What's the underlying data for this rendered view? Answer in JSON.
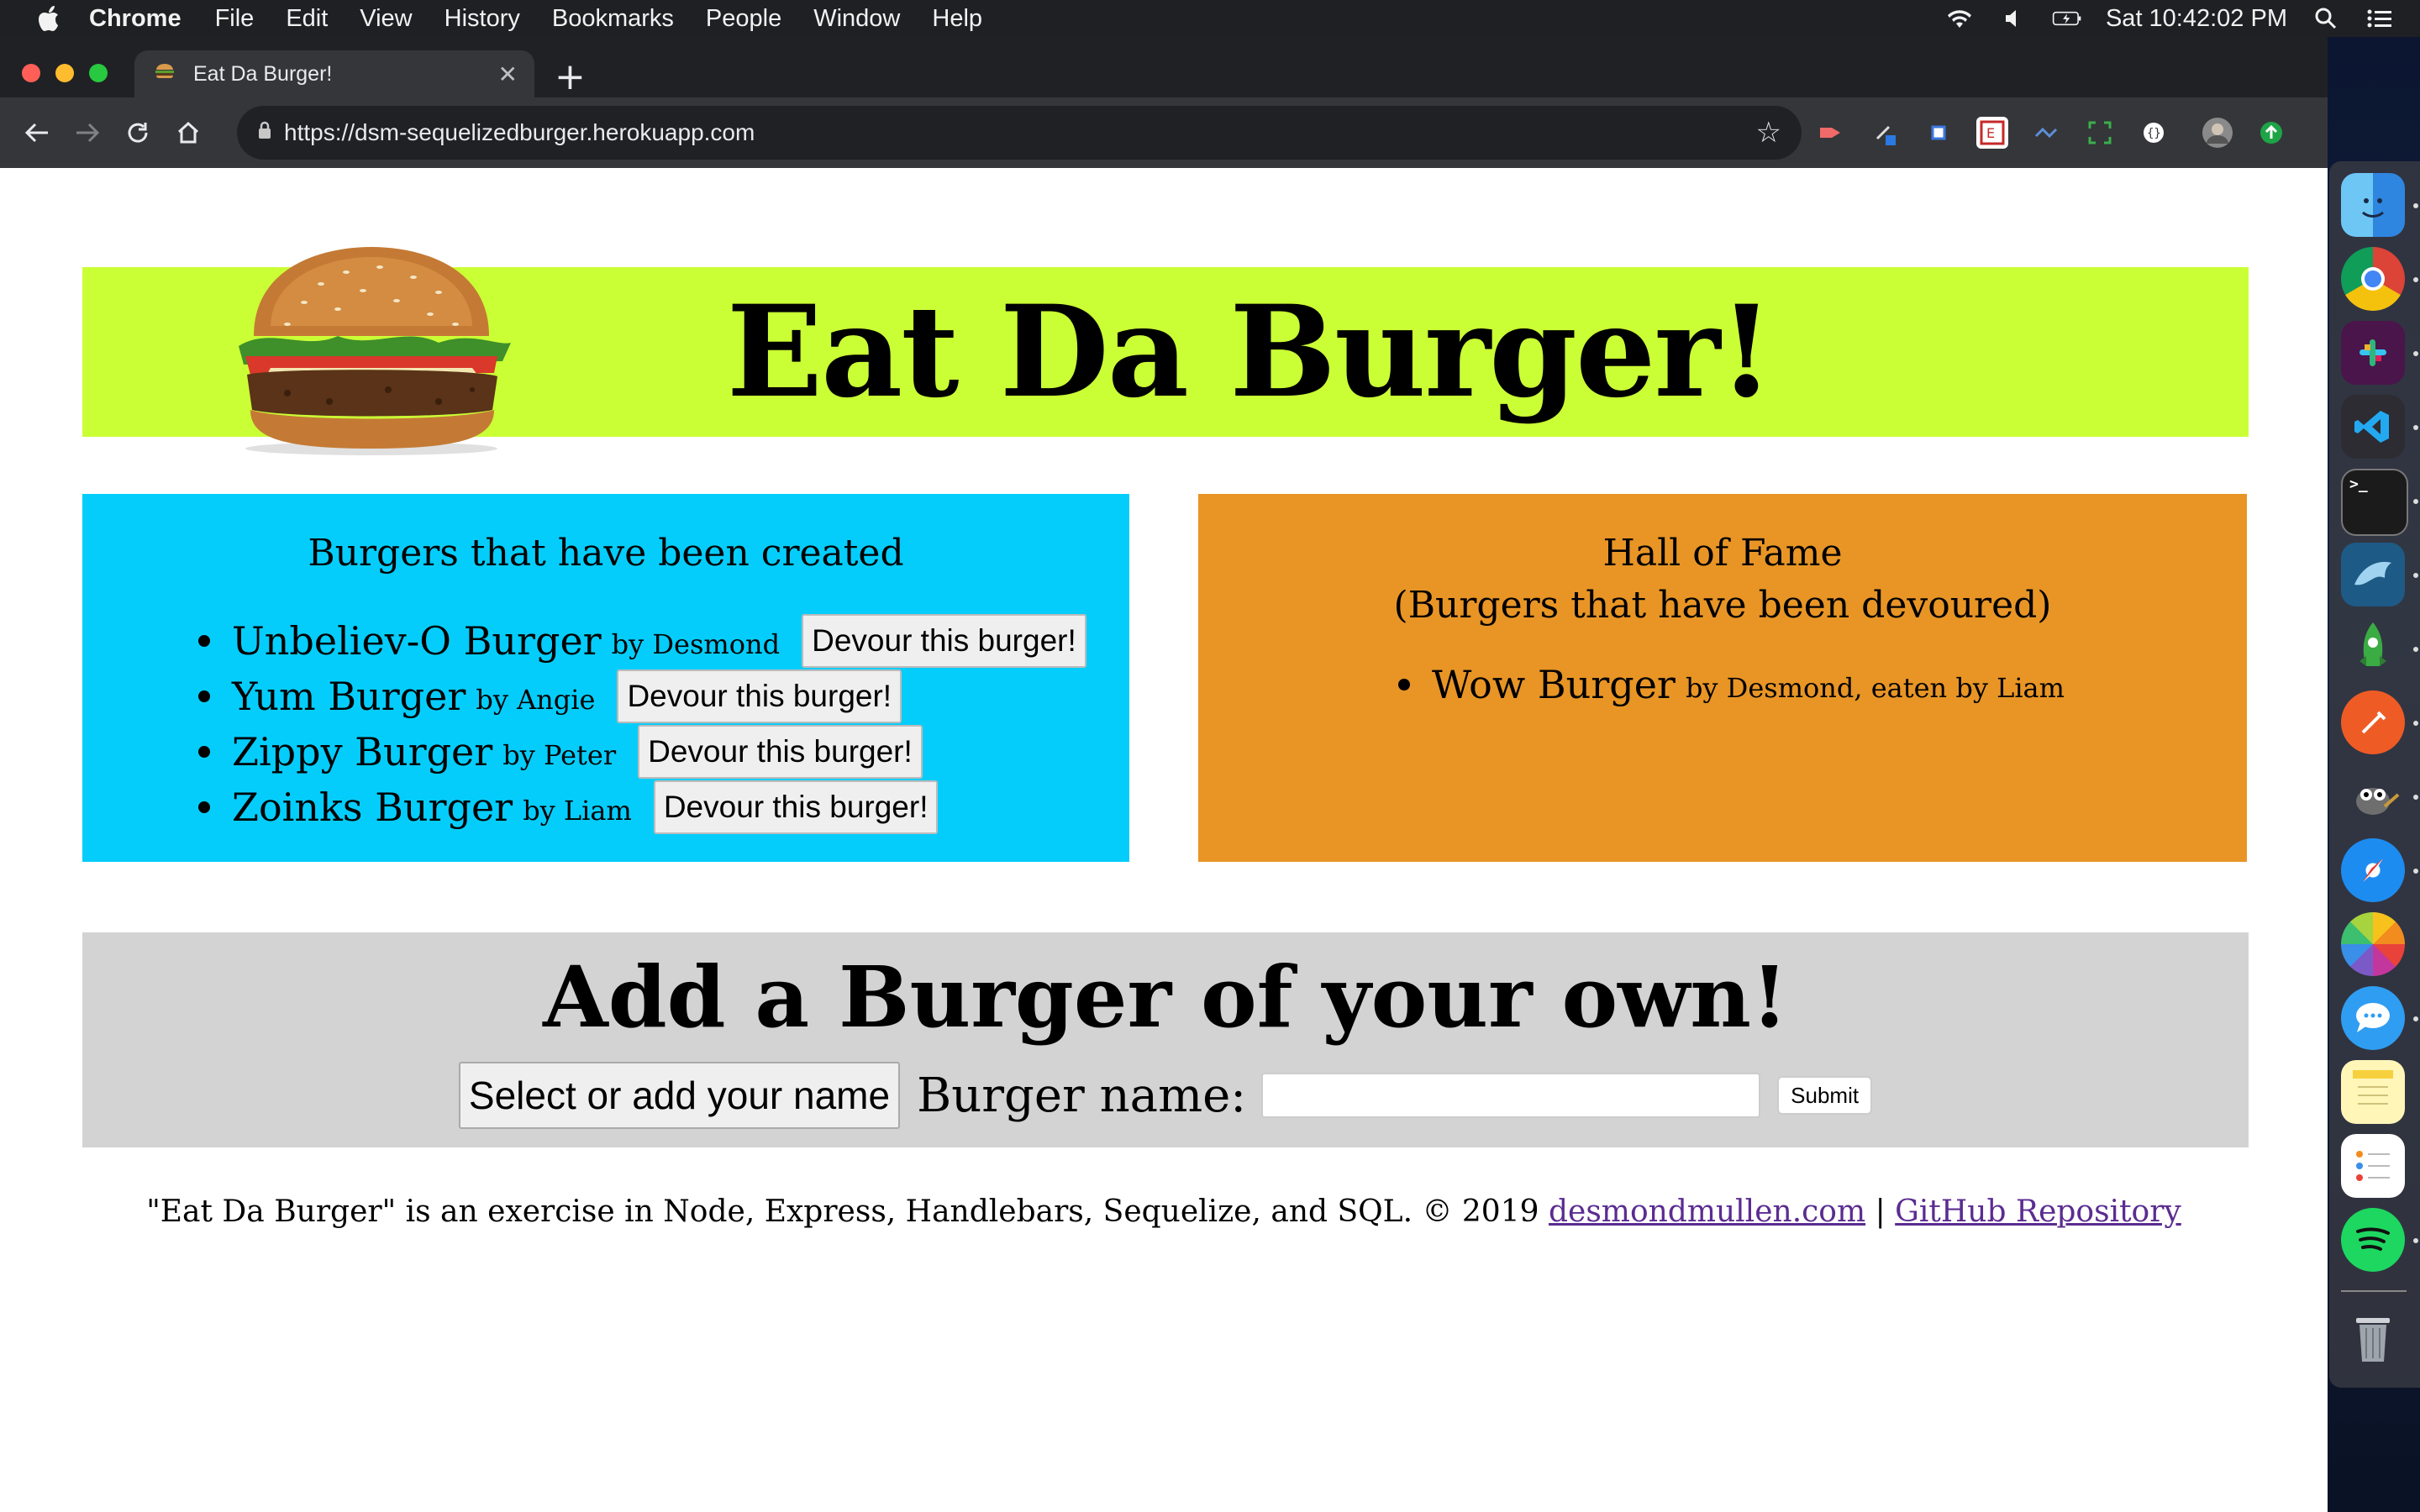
{
  "menubar": {
    "app": "Chrome",
    "items": [
      "File",
      "Edit",
      "View",
      "History",
      "Bookmarks",
      "People",
      "Window",
      "Help"
    ],
    "clock": "Sat 10:42:02 PM"
  },
  "browser": {
    "tab_title": "Eat Da Burger!",
    "url": "https://dsm-sequelizedburger.herokuapp.com"
  },
  "page": {
    "title": "Eat Da Burger!",
    "created_heading": "Burgers that have been created",
    "created": [
      {
        "name": "Unbeliev-O Burger",
        "by": "by Desmond",
        "button": "Devour this burger!"
      },
      {
        "name": "Yum Burger",
        "by": "by Angie",
        "button": "Devour this burger!"
      },
      {
        "name": "Zippy Burger",
        "by": "by Peter",
        "button": "Devour this burger!"
      },
      {
        "name": "Zoinks Burger",
        "by": "by Liam",
        "button": "Devour this burger!"
      }
    ],
    "devoured_heading_1": "Hall of Fame",
    "devoured_heading_2": "(Burgers that have been devoured)",
    "devoured": [
      {
        "name": "Wow Burger",
        "by": "by Desmond, eaten by Liam"
      }
    ],
    "add_heading": "Add a Burger of your own!",
    "name_select": "Select or add your name",
    "burger_label": "Burger name:",
    "burger_input_value": "",
    "submit": "Submit",
    "footer_text": "\"Eat Da Burger\" is an exercise in Node, Express, Handlebars, Sequelize, and SQL. © 2019",
    "footer_link1": "desmondmullen.com",
    "footer_sep": "|",
    "footer_link2": "GitHub Repository"
  },
  "colors": {
    "banner": "#cbff35",
    "created_panel": "#05cdfb",
    "devoured_panel": "#e89526",
    "add_panel": "#d3d3d3",
    "link": "#5b2c91"
  },
  "dock": [
    "finder-icon",
    "chrome-icon",
    "slack-icon",
    "vscode-icon",
    "terminal-icon",
    "mysql-workbench-icon",
    "robo3t-icon",
    "postman-icon",
    "gimp-icon",
    "safari-icon",
    "photos-icon",
    "messages-icon",
    "notes-icon",
    "reminders-icon",
    "spotify-icon",
    "trash-icon"
  ]
}
